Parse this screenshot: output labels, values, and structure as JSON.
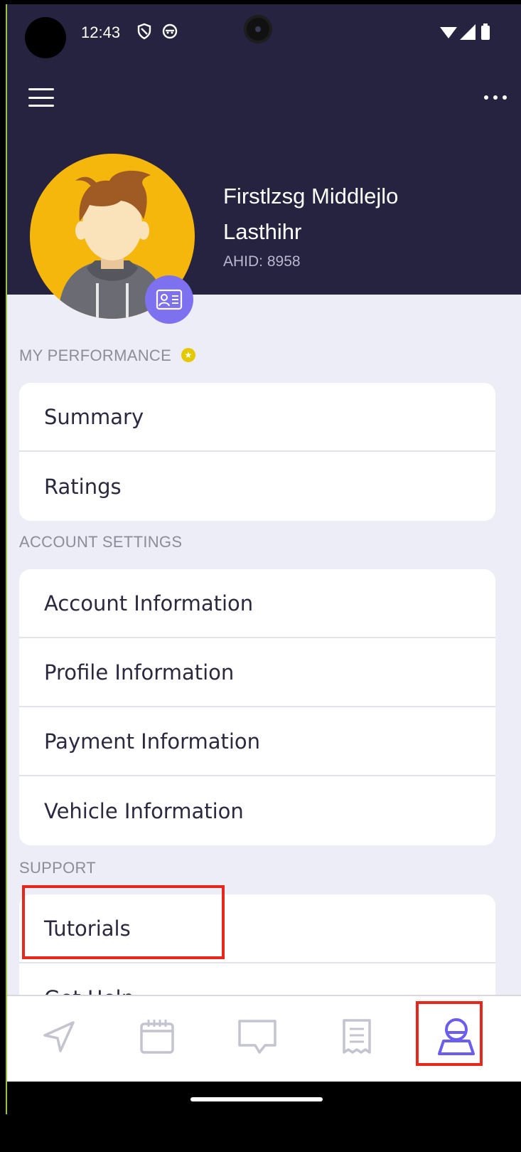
{
  "status_bar": {
    "time": "12:43"
  },
  "profile": {
    "name": "Firstlzsg Middlejlo Lasthihr",
    "id_label": "AHID: 8958"
  },
  "sections": {
    "performance": {
      "title": "MY PERFORMANCE",
      "items": [
        "Summary",
        "Ratings"
      ]
    },
    "account": {
      "title": "ACCOUNT SETTINGS",
      "items": [
        "Account Information",
        "Profile Information",
        "Payment Information",
        "Vehicle Information"
      ]
    },
    "support": {
      "title": "SUPPORT",
      "items": [
        "Tutorials",
        "Get Help"
      ]
    }
  },
  "bottom_nav": {
    "items": [
      {
        "icon": "navigation-icon",
        "active": false
      },
      {
        "icon": "calendar-icon",
        "active": false
      },
      {
        "icon": "chat-icon",
        "active": false
      },
      {
        "icon": "receipt-icon",
        "active": false
      },
      {
        "icon": "profile-icon",
        "active": true
      }
    ]
  },
  "colors": {
    "header_bg": "#262340",
    "accent": "#6a5df0",
    "avatar_bg": "#f5b70c",
    "badge": "#7d71f0",
    "highlight": "#e5281b",
    "inactive_icon": "#c4c4d0"
  }
}
